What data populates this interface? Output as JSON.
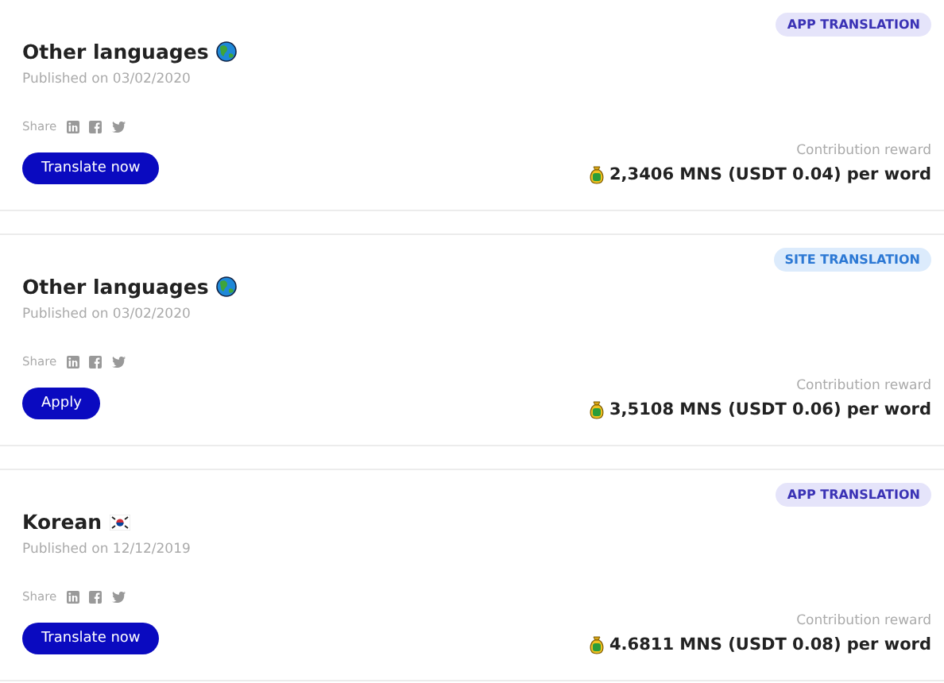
{
  "jobs": [
    {
      "badge": {
        "label": "APP TRANSLATION",
        "kind": "app"
      },
      "title": "Other languages",
      "flag": {
        "kind": "globe"
      },
      "published": "Published on 03/02/2020",
      "share_label": "Share",
      "button": "Translate now",
      "reward_label": "Contribution reward",
      "reward": "2,3406 MNS (USDT 0.04) per word"
    },
    {
      "badge": {
        "label": "SITE TRANSLATION",
        "kind": "site"
      },
      "title": "Other languages",
      "flag": {
        "kind": "globe"
      },
      "published": "Published on 03/02/2020",
      "share_label": "Share",
      "button": "Apply",
      "reward_label": "Contribution reward",
      "reward": "3,5108 MNS (USDT 0.06) per word"
    },
    {
      "badge": {
        "label": "APP TRANSLATION",
        "kind": "app"
      },
      "title": "Korean",
      "flag": {
        "kind": "korea"
      },
      "published": "Published on 12/12/2019",
      "share_label": "Share",
      "button": "Translate now",
      "reward_label": "Contribution reward",
      "reward": "4.6811 MNS (USDT 0.08) per word"
    }
  ]
}
